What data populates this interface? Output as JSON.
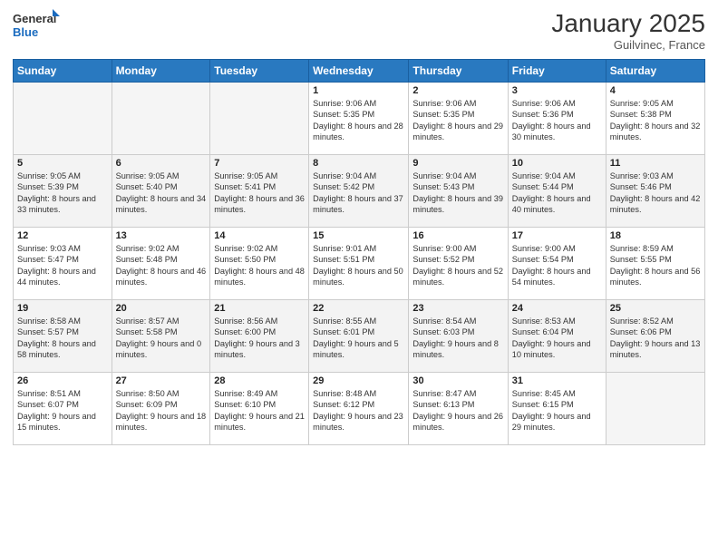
{
  "logo": {
    "general": "General",
    "blue": "Blue"
  },
  "header": {
    "month": "January 2025",
    "location": "Guilvinec, France"
  },
  "weekdays": [
    "Sunday",
    "Monday",
    "Tuesday",
    "Wednesday",
    "Thursday",
    "Friday",
    "Saturday"
  ],
  "weeks": [
    [
      {
        "day": "",
        "info": ""
      },
      {
        "day": "",
        "info": ""
      },
      {
        "day": "",
        "info": ""
      },
      {
        "day": "1",
        "info": "Sunrise: 9:06 AM\nSunset: 5:35 PM\nDaylight: 8 hours and 28 minutes."
      },
      {
        "day": "2",
        "info": "Sunrise: 9:06 AM\nSunset: 5:35 PM\nDaylight: 8 hours and 29 minutes."
      },
      {
        "day": "3",
        "info": "Sunrise: 9:06 AM\nSunset: 5:36 PM\nDaylight: 8 hours and 30 minutes."
      },
      {
        "day": "4",
        "info": "Sunrise: 9:05 AM\nSunset: 5:38 PM\nDaylight: 8 hours and 32 minutes."
      }
    ],
    [
      {
        "day": "5",
        "info": "Sunrise: 9:05 AM\nSunset: 5:39 PM\nDaylight: 8 hours and 33 minutes."
      },
      {
        "day": "6",
        "info": "Sunrise: 9:05 AM\nSunset: 5:40 PM\nDaylight: 8 hours and 34 minutes."
      },
      {
        "day": "7",
        "info": "Sunrise: 9:05 AM\nSunset: 5:41 PM\nDaylight: 8 hours and 36 minutes."
      },
      {
        "day": "8",
        "info": "Sunrise: 9:04 AM\nSunset: 5:42 PM\nDaylight: 8 hours and 37 minutes."
      },
      {
        "day": "9",
        "info": "Sunrise: 9:04 AM\nSunset: 5:43 PM\nDaylight: 8 hours and 39 minutes."
      },
      {
        "day": "10",
        "info": "Sunrise: 9:04 AM\nSunset: 5:44 PM\nDaylight: 8 hours and 40 minutes."
      },
      {
        "day": "11",
        "info": "Sunrise: 9:03 AM\nSunset: 5:46 PM\nDaylight: 8 hours and 42 minutes."
      }
    ],
    [
      {
        "day": "12",
        "info": "Sunrise: 9:03 AM\nSunset: 5:47 PM\nDaylight: 8 hours and 44 minutes."
      },
      {
        "day": "13",
        "info": "Sunrise: 9:02 AM\nSunset: 5:48 PM\nDaylight: 8 hours and 46 minutes."
      },
      {
        "day": "14",
        "info": "Sunrise: 9:02 AM\nSunset: 5:50 PM\nDaylight: 8 hours and 48 minutes."
      },
      {
        "day": "15",
        "info": "Sunrise: 9:01 AM\nSunset: 5:51 PM\nDaylight: 8 hours and 50 minutes."
      },
      {
        "day": "16",
        "info": "Sunrise: 9:00 AM\nSunset: 5:52 PM\nDaylight: 8 hours and 52 minutes."
      },
      {
        "day": "17",
        "info": "Sunrise: 9:00 AM\nSunset: 5:54 PM\nDaylight: 8 hours and 54 minutes."
      },
      {
        "day": "18",
        "info": "Sunrise: 8:59 AM\nSunset: 5:55 PM\nDaylight: 8 hours and 56 minutes."
      }
    ],
    [
      {
        "day": "19",
        "info": "Sunrise: 8:58 AM\nSunset: 5:57 PM\nDaylight: 8 hours and 58 minutes."
      },
      {
        "day": "20",
        "info": "Sunrise: 8:57 AM\nSunset: 5:58 PM\nDaylight: 9 hours and 0 minutes."
      },
      {
        "day": "21",
        "info": "Sunrise: 8:56 AM\nSunset: 6:00 PM\nDaylight: 9 hours and 3 minutes."
      },
      {
        "day": "22",
        "info": "Sunrise: 8:55 AM\nSunset: 6:01 PM\nDaylight: 9 hours and 5 minutes."
      },
      {
        "day": "23",
        "info": "Sunrise: 8:54 AM\nSunset: 6:03 PM\nDaylight: 9 hours and 8 minutes."
      },
      {
        "day": "24",
        "info": "Sunrise: 8:53 AM\nSunset: 6:04 PM\nDaylight: 9 hours and 10 minutes."
      },
      {
        "day": "25",
        "info": "Sunrise: 8:52 AM\nSunset: 6:06 PM\nDaylight: 9 hours and 13 minutes."
      }
    ],
    [
      {
        "day": "26",
        "info": "Sunrise: 8:51 AM\nSunset: 6:07 PM\nDaylight: 9 hours and 15 minutes."
      },
      {
        "day": "27",
        "info": "Sunrise: 8:50 AM\nSunset: 6:09 PM\nDaylight: 9 hours and 18 minutes."
      },
      {
        "day": "28",
        "info": "Sunrise: 8:49 AM\nSunset: 6:10 PM\nDaylight: 9 hours and 21 minutes."
      },
      {
        "day": "29",
        "info": "Sunrise: 8:48 AM\nSunset: 6:12 PM\nDaylight: 9 hours and 23 minutes."
      },
      {
        "day": "30",
        "info": "Sunrise: 8:47 AM\nSunset: 6:13 PM\nDaylight: 9 hours and 26 minutes."
      },
      {
        "day": "31",
        "info": "Sunrise: 8:45 AM\nSunset: 6:15 PM\nDaylight: 9 hours and 29 minutes."
      },
      {
        "day": "",
        "info": ""
      }
    ]
  ]
}
